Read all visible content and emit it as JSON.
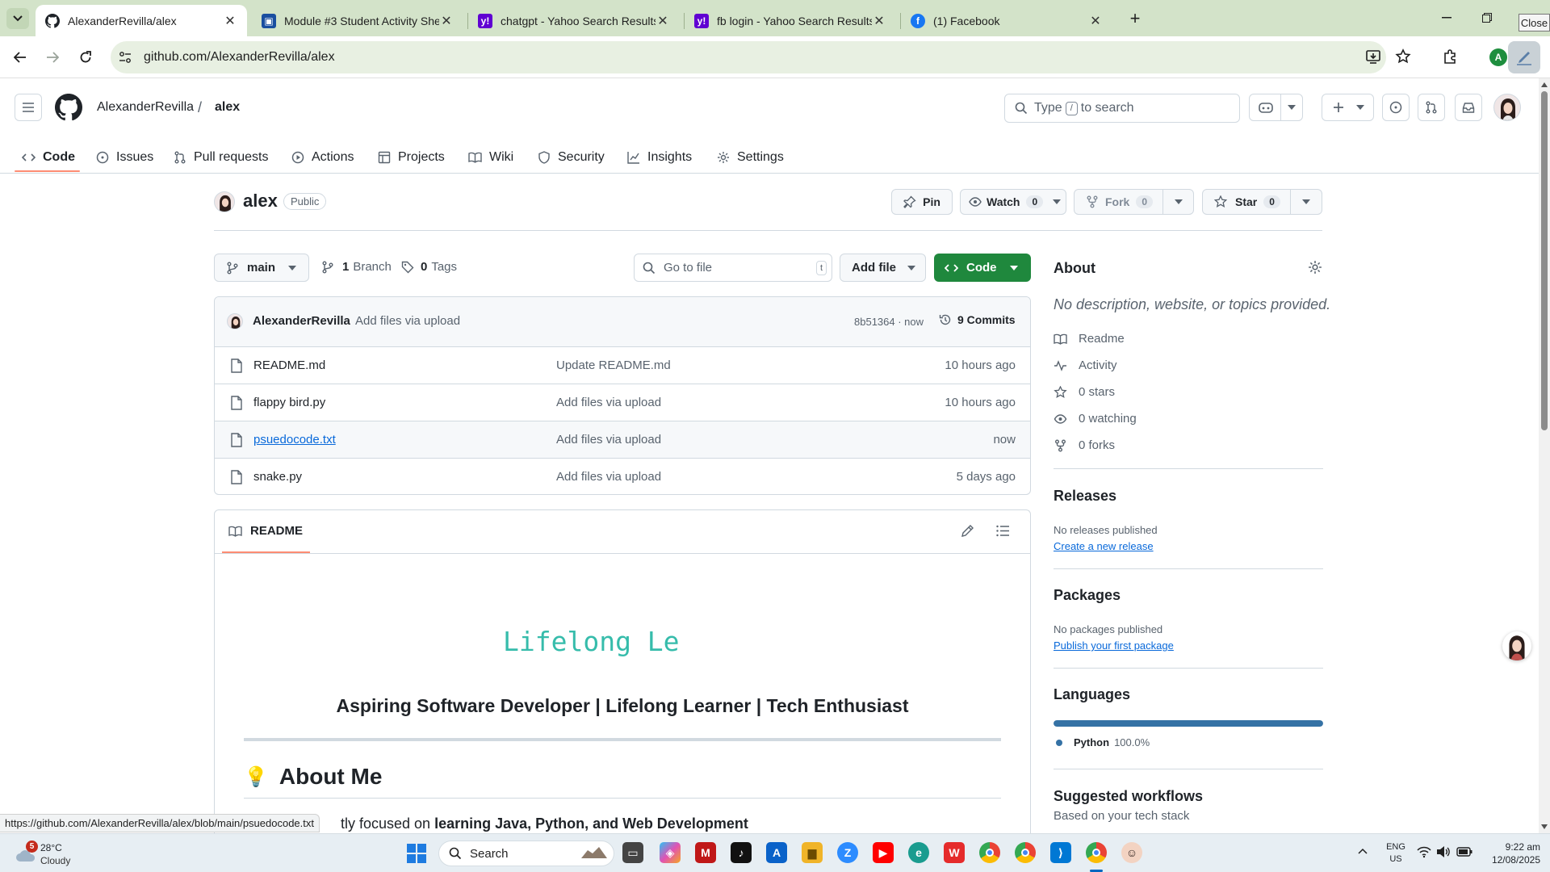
{
  "browser": {
    "tabs": [
      {
        "title": "AlexanderRevilla/alex",
        "active": true,
        "icon": "github-icon"
      },
      {
        "title": "Module #3 Student Activity She",
        "active": false,
        "icon": "docs-icon"
      },
      {
        "title": "chatgpt - Yahoo Search Results",
        "active": false,
        "icon": "yahoo-icon"
      },
      {
        "title": "fb login - Yahoo Search Results",
        "active": false,
        "icon": "yahoo-icon"
      },
      {
        "title": "(1) Facebook",
        "active": false,
        "icon": "facebook-icon"
      }
    ],
    "url": "github.com/AlexanderRevilla/alex",
    "close_tooltip": "Close",
    "profile_initial": "A"
  },
  "header": {
    "owner": "AlexanderRevilla",
    "separator": "/",
    "repo": "alex",
    "search_prefix": "Type",
    "search_key": "/",
    "search_suffix": "to search"
  },
  "repo_tabs": [
    {
      "label": "Code",
      "icon": "code-icon",
      "active": true
    },
    {
      "label": "Issues",
      "icon": "issue-icon"
    },
    {
      "label": "Pull requests",
      "icon": "pull-request-icon"
    },
    {
      "label": "Actions",
      "icon": "play-icon"
    },
    {
      "label": "Projects",
      "icon": "table-icon"
    },
    {
      "label": "Wiki",
      "icon": "book-icon"
    },
    {
      "label": "Security",
      "icon": "shield-icon"
    },
    {
      "label": "Insights",
      "icon": "graph-icon"
    },
    {
      "label": "Settings",
      "icon": "gear-icon"
    }
  ],
  "repo": {
    "name": "alex",
    "visibility": "Public",
    "pin_label": "Pin",
    "watch_label": "Watch",
    "watch_count": "0",
    "fork_label": "Fork",
    "fork_count": "0",
    "star_label": "Star",
    "star_count": "0"
  },
  "toolbar": {
    "branch": "main",
    "branch_count": "1",
    "branch_label": "Branch",
    "tag_count": "0",
    "tag_label": "Tags",
    "goto_placeholder": "Go to file",
    "goto_key": "t",
    "add_file": "Add file",
    "code_button": "Code"
  },
  "commit": {
    "author": "AlexanderRevilla",
    "message": "Add files via upload",
    "sha_time": "8b51364 · now",
    "commits_label": "9 Commits"
  },
  "files": [
    {
      "name": "README.md",
      "message": "Update README.md",
      "date": "10 hours ago",
      "link": false
    },
    {
      "name": "flappy bird.py",
      "message": "Add files via upload",
      "date": "10 hours ago",
      "link": false
    },
    {
      "name": "psuedocode.txt",
      "message": "Add files via upload",
      "date": "now",
      "link": true
    },
    {
      "name": "snake.py",
      "message": "Add files via upload",
      "date": "5 days ago",
      "link": false
    }
  ],
  "readme": {
    "tab_label": "README",
    "typing_title": "Lifelong Le",
    "tagline": "Aspiring Software Developer | Lifelong Learner | Tech Enthusiast",
    "about_emoji": "💡",
    "about_heading": "About Me",
    "body_fragment": "tly focused on ",
    "body_bold": "learning Java, Python, and Web Development"
  },
  "status_url": "https://github.com/AlexanderRevilla/alex/blob/main/psuedocode.txt",
  "about": {
    "heading": "About",
    "description": "No description, website, or topics provided.",
    "items": [
      {
        "label": "Readme",
        "icon": "book-icon"
      },
      {
        "label": "Activity",
        "icon": "pulse-icon"
      },
      {
        "label": "0 stars",
        "icon": "star-icon"
      },
      {
        "label": "0 watching",
        "icon": "eye-icon"
      },
      {
        "label": "0 forks",
        "icon": "fork-icon"
      }
    ]
  },
  "releases": {
    "heading": "Releases",
    "status": "No releases published",
    "link": "Create a new release"
  },
  "packages": {
    "heading": "Packages",
    "status": "No packages published",
    "link": "Publish your first package"
  },
  "languages": {
    "heading": "Languages",
    "name": "Python",
    "percent": "100.0%",
    "fraction": 1.0,
    "color": "#3572A5"
  },
  "workflows": {
    "heading": "Suggested workflows",
    "subtitle": "Based on your tech stack"
  },
  "taskbar": {
    "weather_temp": "28°C",
    "weather_desc": "Cloudy",
    "weather_badge": "5",
    "search_label": "Search",
    "lang_top": "ENG",
    "lang_bottom": "US",
    "time": "9:22 am",
    "date": "12/08/2025"
  },
  "colors": {
    "accent_green": "#1f883d",
    "link_blue": "#0969da",
    "tab_underline": "#fd8c73",
    "chrome_green": "#d3e3c9"
  }
}
